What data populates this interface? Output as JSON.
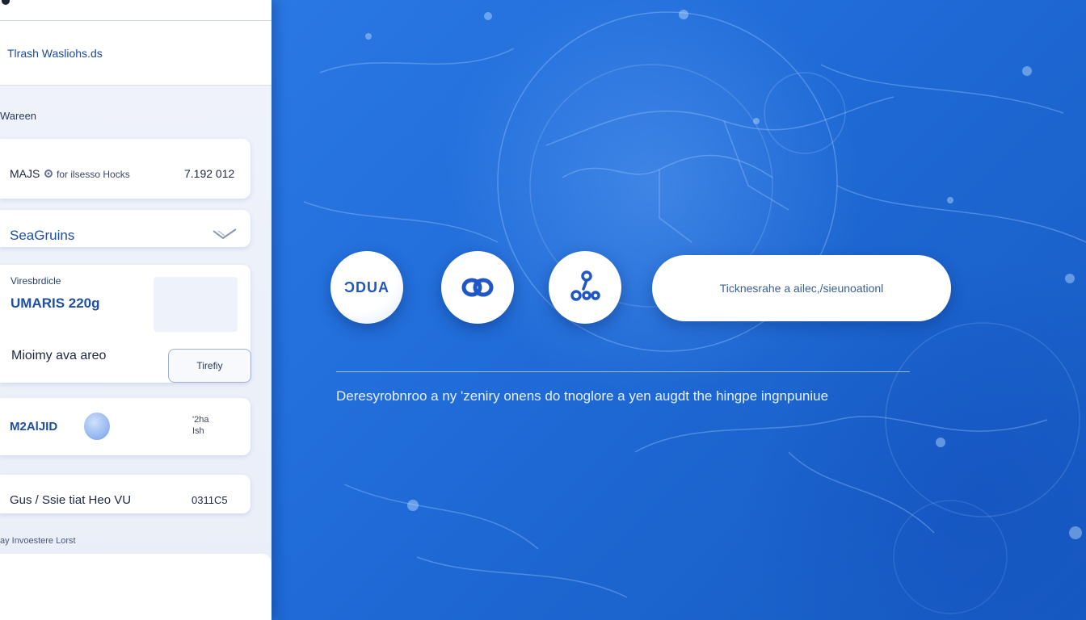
{
  "panel": {
    "header_title": "Tlrash Wasliohs.ds",
    "section_label": "Wareen",
    "card1": {
      "code": "MAJS",
      "desc": "for ilsesso  Hocks",
      "number": "7.192 012"
    },
    "card2": {
      "name": "SeaGruins"
    },
    "card3": {
      "label": "Viresbrdicle",
      "value": "UMARIS 220g",
      "sub": "Mioimy ava areo",
      "button_label": "Tirefiy"
    },
    "card4": {
      "code": "M2AlJID",
      "mini": "'2ha\nIsh"
    },
    "card5": {
      "desc": "Gus / Ssie tiat Heo  VU",
      "number": "0311C5"
    },
    "footnote": "ay Invoestere   Lorst"
  },
  "hero": {
    "orb1_label": "ƆDUA",
    "search_text": "Ticknesrahe a ailec,/sieunoationl",
    "caption": "Deresyrobnroo a ny  'zeniry onens do tnoglore a yen augdt  the hingpe ingnpuniue",
    "accent_color": "#1d63cc"
  },
  "icons": {
    "orb2": "link-chain-icon",
    "orb3": "nodes-icon",
    "card1": "gear-icon",
    "card2": "chevron-down-icon"
  }
}
